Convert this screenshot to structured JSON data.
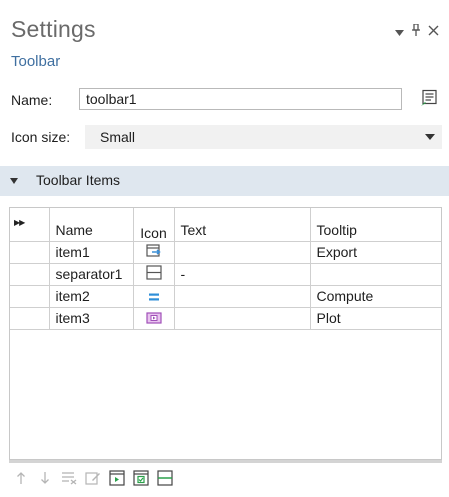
{
  "header": {
    "title": "Settings",
    "subtitle": "Toolbar",
    "controls": [
      "dropdown-icon",
      "pin-icon",
      "close-icon"
    ]
  },
  "form": {
    "name_label": "Name:",
    "name_value": "toolbar1",
    "icon_size_label": "Icon size:",
    "icon_size_value": "Small"
  },
  "section": {
    "label": "Toolbar Items",
    "expanded": true
  },
  "table": {
    "columns": [
      "Name",
      "Icon",
      "Text",
      "Tooltip"
    ],
    "rows": [
      {
        "name": "item1",
        "icon": "export-icon",
        "text": "",
        "tooltip": "Export"
      },
      {
        "name": "separator1",
        "icon": "separator-icon",
        "text": "-",
        "tooltip": ""
      },
      {
        "name": "item2",
        "icon": "compute-icon",
        "text": "",
        "tooltip": "Compute"
      },
      {
        "name": "item3",
        "icon": "plot-icon",
        "text": "",
        "tooltip": "Plot"
      }
    ]
  },
  "bottom_toolbar": [
    "move-up-icon",
    "move-down-icon",
    "delete-list-icon",
    "edit-icon",
    "add-item-icon",
    "add-checkbox-item-icon",
    "add-separator-icon"
  ],
  "colors": {
    "section_bg": "#dfe7ef",
    "subtitle": "#3f6fa0",
    "accent_blue": "#3c8fd6",
    "accent_purple": "#a04fb8"
  }
}
